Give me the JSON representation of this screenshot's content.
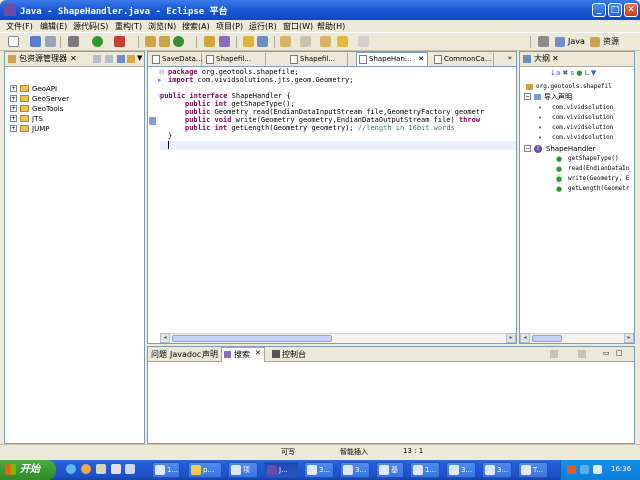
{
  "window": {
    "title": "Java - ShapeHandler.java - Eclipse 平台"
  },
  "menu": [
    "文件(F)",
    "编辑(E)",
    "源代码(S)",
    "重构(T)",
    "浏览(N)",
    "搜索(A)",
    "项目(P)",
    "运行(R)",
    "窗口(W)",
    "帮助(H)"
  ],
  "perspectives": {
    "java": "Java",
    "resource": "资源"
  },
  "package_explorer": {
    "title": "包资源管理器",
    "items": [
      "GeoAPI",
      "GeoServer",
      "GeoTools",
      "JTS",
      "JUMP"
    ]
  },
  "editor": {
    "tabs": [
      "SaveData...",
      "Shapefil...",
      "Shapefil...",
      "ShapeHan...",
      "CommonCa..."
    ],
    "active_tab_index": 3,
    "code": {
      "l1_kw": "package",
      "l1_rest": " org.geotools.shapefile;",
      "l2_kw": "import",
      "l2_rest": " com.vividsolutions.jts.geom.Geometry;",
      "l3_kw": "public interface",
      "l3_rest": " ShapeHandler {",
      "l4_kw": "public int",
      "l4_rest": " getShapeType();",
      "l5_kw": "public",
      "l5_rest": " Geometry read(EndianDataInputStream file,GeometryFactory geometr",
      "l6_kw": "public void",
      "l6_rest": " write(Geometry geometry,EndianDataOutputStream file) ",
      "l6_tail": "throw",
      "l7_kw": "public int",
      "l7_rest": " getLength(Geometry geometry); ",
      "l7_comment": "//length in 16bit words",
      "l8": "}"
    }
  },
  "outline": {
    "title": "大纲",
    "package": "org.geotools.shapefil",
    "imports_label": "导入声明",
    "imports": [
      "com.vividsolution",
      "com.vividsolution",
      "com.vividsolution",
      "com.vividsolution"
    ],
    "type": "ShapeHandler",
    "methods": [
      "getShapeType()",
      "read(EndianDataIn",
      "write(Geometry, E",
      "getLength(Geometr"
    ]
  },
  "bottom": {
    "tabs": [
      "问题",
      "Javadoc",
      "声明",
      "搜索",
      "控制台"
    ],
    "active_tab_index": 3
  },
  "status": {
    "writable": "可写",
    "insert_mode": "智能插入",
    "position": "13 : 1"
  },
  "taskbar": {
    "start": "开始",
    "items": [
      "1...",
      "p...",
      "项",
      "J...",
      "3...",
      "3...",
      "基",
      "1...",
      "3...",
      "3...",
      "T..."
    ],
    "clock": "16:36"
  }
}
